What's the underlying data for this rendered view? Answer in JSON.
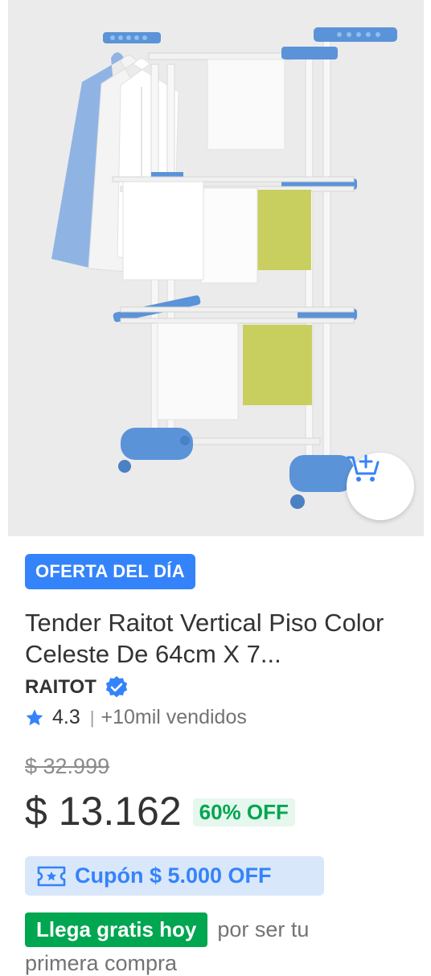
{
  "product": {
    "image_alt": "Tender Raitot vertical de piso color celeste",
    "deal_badge": "OFERTA DEL DÍA",
    "title": "Tender Raitot Vertical Piso Color Celeste De 64cm X 7...",
    "brand": "RAITOT",
    "rating": "4.3",
    "sold": "+10mil vendidos",
    "old_price": "$ 32.999",
    "price": "$ 13.162",
    "discount": "60% OFF",
    "coupon": "Cupón $ 5.000 OFF",
    "shipping_badge": "Llega gratis hoy",
    "shipping_text": "por ser tu",
    "shipping_text_2": "primera compra"
  },
  "icons": {
    "cart": "add-to-cart-icon",
    "verified": "verified-badge-icon",
    "star": "star-icon",
    "coupon": "coupon-ticket-icon"
  },
  "colors": {
    "accent_blue": "#3483fa",
    "green": "#00a650",
    "rack_blue": "#5b93d8",
    "image_bg": "#ebebeb"
  }
}
